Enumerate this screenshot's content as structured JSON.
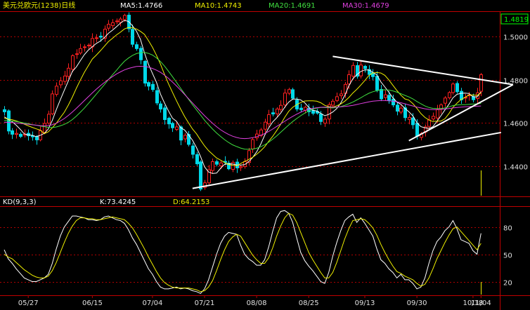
{
  "header": {
    "title": "美元兑欧元(1238)日线",
    "ma5": "MA5:1.4766",
    "ma10": "MA10:1.4743",
    "ma20": "MA20:1.4691",
    "ma30": "MA30:1.4679",
    "last_price": "1.4819"
  },
  "kd_panel": {
    "label": "KD(9,3,3)",
    "k_value": "K:73.4245",
    "d_value": "D:64.2153"
  },
  "colors": {
    "background": "#000000",
    "up_candle": "#ff2020",
    "down_candle": "#00d8e8",
    "ma5": "#ffffff",
    "ma10": "#f0f000",
    "ma20": "#40e040",
    "ma30": "#e040e0",
    "grid": "#b00000",
    "axis_text": "#e0e0e0",
    "trendline": "#ffffff",
    "k_line": "#ffffff",
    "d_line": "#f0f000",
    "last_price_box": "#00ff00",
    "volume_bar": "#f0f000"
  },
  "chart_data": [
    {
      "type": "candlestick",
      "title": "美元兑欧元(1238)日线",
      "ylim": [
        1.426,
        1.5115
      ],
      "y_ticks": [
        "1.5000",
        "1.4800",
        "1.4600",
        "1.4400"
      ],
      "y_tick_values": [
        1.5,
        1.48,
        1.46,
        1.44
      ],
      "x_ticks": [
        "05/27",
        "06/15",
        "07/04",
        "07/21",
        "08/08",
        "08/25",
        "09/13",
        "09/30",
        "10/18",
        "11/04"
      ],
      "grid": true,
      "close": [
        1.4652,
        1.4563,
        1.4548,
        1.4552,
        1.4538,
        1.4548,
        1.4541,
        1.4536,
        1.4522,
        1.4565,
        1.4598,
        1.4641,
        1.4735,
        1.4771,
        1.4796,
        1.4818,
        1.4854,
        1.4912,
        1.4921,
        1.4945,
        1.4953,
        1.4961,
        1.4992,
        1.4995,
        1.4998,
        1.5035,
        1.5058,
        1.5065,
        1.5073,
        1.5082,
        1.5099,
        1.5037,
        1.4965,
        1.4945,
        1.4893,
        1.4785,
        1.4771,
        1.4755,
        1.4693,
        1.4665,
        1.4616,
        1.4596,
        1.4578,
        1.4582,
        1.4521,
        1.4543,
        1.4501,
        1.4455,
        1.4411,
        1.4294,
        1.4323,
        1.4383,
        1.4421,
        1.4409,
        1.4415,
        1.4418,
        1.4388,
        1.4417,
        1.4392,
        1.4398,
        1.4421,
        1.4472,
        1.4523,
        1.4549,
        1.4568,
        1.4604,
        1.4639,
        1.4642,
        1.4665,
        1.4682,
        1.4739,
        1.4755,
        1.4715,
        1.4665,
        1.4662,
        1.4673,
        1.4652,
        1.4645,
        1.4646,
        1.4607,
        1.4618,
        1.4685,
        1.4701,
        1.4722,
        1.4735,
        1.4779,
        1.4824,
        1.4867,
        1.4817,
        1.4869,
        1.4852,
        1.4825,
        1.4815,
        1.4753,
        1.4712,
        1.4731,
        1.4705,
        1.4684,
        1.4655,
        1.4669,
        1.4625,
        1.4626,
        1.4592,
        1.4539,
        1.4551,
        1.4582,
        1.4614,
        1.4631,
        1.4662,
        1.4684,
        1.4716,
        1.4741,
        1.4781,
        1.4745,
        1.4708,
        1.4719,
        1.4731,
        1.4708,
        1.474,
        1.4824
      ],
      "series": [
        {
          "name": "MA5:1.4766",
          "values": [
            1.4629,
            1.4617,
            1.4606,
            1.459,
            1.4571,
            1.455,
            1.4545,
            1.4543,
            1.4537,
            1.4543,
            1.4552,
            1.4572,
            1.4612,
            1.4662,
            1.4708,
            1.4752,
            1.4795,
            1.4839,
            1.486,
            1.4889,
            1.4917,
            1.4938,
            1.4954,
            1.4969,
            1.498,
            1.4996,
            1.5016,
            1.503,
            1.5046,
            1.5063,
            1.5076,
            1.5071,
            1.5051,
            1.5026,
            1.4988,
            1.4925,
            1.4872,
            1.483,
            1.4789,
            1.4734,
            1.4693,
            1.4656,
            1.4622,
            1.4608,
            1.4579,
            1.4568,
            1.4545,
            1.452,
            1.4486,
            1.4445,
            1.4397,
            1.4373,
            1.4366,
            1.4368,
            1.439,
            1.4409,
            1.4411,
            1.441,
            1.4406,
            1.4405,
            1.4407,
            1.442,
            1.444,
            1.4466,
            1.4501,
            1.4543,
            1.4577,
            1.4605,
            1.4624,
            1.4646,
            1.4673,
            1.4697,
            1.4711,
            1.4711,
            1.4707,
            1.4694,
            1.4673,
            1.4659,
            1.4656,
            1.4645,
            1.4634,
            1.464,
            1.4651,
            1.4667,
            1.4693,
            1.4728,
            1.4772,
            1.4805,
            1.4824,
            1.4839,
            1.4846,
            1.4846,
            1.4835,
            1.4823,
            1.4791,
            1.4767,
            1.4743,
            1.4717,
            1.4697,
            1.4687,
            1.4668,
            1.4652,
            1.4633,
            1.4602,
            1.4583,
            1.4578,
            1.4575,
            1.4583,
            1.4608,
            1.4634,
            1.4661,
            1.4687,
            1.4717,
            1.4733,
            1.4738,
            1.4739,
            1.4737,
            1.4722,
            1.4721,
            1.4744
          ]
        },
        {
          "name": "MA10:1.4743",
          "values": [
            1.4623,
            1.4618,
            1.4615,
            1.461,
            1.4603,
            1.4595,
            1.4587,
            1.458,
            1.4573,
            1.4567,
            1.4551,
            1.4559,
            1.4578,
            1.4599,
            1.4625,
            1.465,
            1.4683,
            1.472,
            1.4761,
            1.4799,
            1.4835,
            1.4866,
            1.4897,
            1.4915,
            1.4935,
            1.4956,
            1.4977,
            1.4992,
            1.5008,
            1.5021,
            1.5036,
            1.5043,
            1.5041,
            1.5036,
            1.5025,
            1.5011,
            1.4982,
            1.4951,
            1.4914,
            1.4873,
            1.4826,
            1.4782,
            1.4742,
            1.4703,
            1.4666,
            1.4631,
            1.4601,
            1.4572,
            1.455,
            1.4521,
            1.4494,
            1.4472,
            1.4455,
            1.4438,
            1.4428,
            1.4417,
            1.4408,
            1.4404,
            1.4402,
            1.4412,
            1.4422,
            1.4431,
            1.4441,
            1.4455,
            1.4471,
            1.449,
            1.4515,
            1.4538,
            1.4565,
            1.4594,
            1.4626,
            1.4654,
            1.4673,
            1.4685,
            1.4695,
            1.4702,
            1.4703,
            1.4703,
            1.4701,
            1.4694,
            1.4682,
            1.4676,
            1.4674,
            1.468,
            1.4688,
            1.4701,
            1.4718,
            1.4739,
            1.4756,
            1.4776,
            1.4797,
            1.482,
            1.4832,
            1.4834,
            1.4832,
            1.4821,
            1.48,
            1.4775,
            1.4751,
            1.4729,
            1.4712,
            1.4706,
            1.469,
            1.4668,
            1.4644,
            1.4626,
            1.4614,
            1.4607,
            1.4609,
            1.4609,
            1.462,
            1.4644,
            1.4673,
            1.4692,
            1.4709,
            1.4719,
            1.473,
            1.473,
            1.4728,
            1.474
          ]
        },
        {
          "name": "MA20:1.4691",
          "values": [
            1.4612,
            1.4611,
            1.4609,
            1.4607,
            1.4604,
            1.46,
            1.4597,
            1.4593,
            1.459,
            1.4586,
            1.4583,
            1.458,
            1.4579,
            1.4582,
            1.4587,
            1.4594,
            1.4603,
            1.4616,
            1.4632,
            1.465,
            1.4669,
            1.469,
            1.4712,
            1.4734,
            1.4756,
            1.4778,
            1.4801,
            1.4823,
            1.4844,
            1.4866,
            1.4886,
            1.4901,
            1.4913,
            1.4922,
            1.4926,
            1.4927,
            1.4923,
            1.4915,
            1.4902,
            1.4885,
            1.4864,
            1.484,
            1.4815,
            1.4789,
            1.4762,
            1.4736,
            1.471,
            1.4685,
            1.4661,
            1.4637,
            1.4613,
            1.4592,
            1.4572,
            1.4554,
            1.4538,
            1.4523,
            1.451,
            1.4499,
            1.4491,
            1.4484,
            1.4479,
            1.4478,
            1.4479,
            1.4483,
            1.449,
            1.4499,
            1.4511,
            1.4525,
            1.454,
            1.4557,
            1.4574,
            1.4591,
            1.4607,
            1.4621,
            1.4634,
            1.4646,
            1.4656,
            1.4664,
            1.4669,
            1.4672,
            1.4672,
            1.4671,
            1.467,
            1.4672,
            1.4676,
            1.4682,
            1.4689,
            1.4697,
            1.4707,
            1.4717,
            1.4728,
            1.4738,
            1.4745,
            1.475,
            1.4753,
            1.4754,
            1.4753,
            1.4749,
            1.4743,
            1.4736,
            1.4728,
            1.4721,
            1.4712,
            1.47,
            1.4689,
            1.4679,
            1.4672,
            1.4668,
            1.4667,
            1.4667,
            1.467,
            1.4675,
            1.4681,
            1.4684,
            1.4685,
            1.4685,
            1.4687,
            1.4688,
            1.4688,
            1.4691
          ]
        },
        {
          "name": "MA30:1.4679",
          "values": [
            1.4604,
            1.4603,
            1.4602,
            1.46,
            1.4598,
            1.4596,
            1.4594,
            1.4592,
            1.459,
            1.4588,
            1.4587,
            1.4588,
            1.4592,
            1.4599,
            1.4609,
            1.4621,
            1.4635,
            1.4651,
            1.4668,
            1.4686,
            1.4704,
            1.4722,
            1.474,
            1.4757,
            1.4773,
            1.4788,
            1.4802,
            1.4815,
            1.4827,
            1.4837,
            1.4846,
            1.4853,
            1.4858,
            1.4862,
            1.4863,
            1.4862,
            1.4859,
            1.4853,
            1.4845,
            1.4835,
            1.4822,
            1.4807,
            1.479,
            1.4772,
            1.4753,
            1.4733,
            1.4713,
            1.4693,
            1.4673,
            1.4653,
            1.4634,
            1.4616,
            1.4599,
            1.4583,
            1.4569,
            1.4557,
            1.4547,
            1.4539,
            1.4533,
            1.4529,
            1.4528,
            1.4529,
            1.4532,
            1.4537,
            1.4543,
            1.4551,
            1.4561,
            1.4572,
            1.4584,
            1.4596,
            1.4608,
            1.462,
            1.4631,
            1.4641,
            1.465,
            1.4658,
            1.4664,
            1.4668,
            1.4671,
            1.4673,
            1.4674,
            1.4674,
            1.4674,
            1.4674,
            1.4675,
            1.4677,
            1.4679,
            1.4682,
            1.4686,
            1.469,
            1.4694,
            1.4698,
            1.4701,
            1.4703,
            1.4704,
            1.4704,
            1.4703,
            1.4701,
            1.4698,
            1.4694,
            1.4689,
            1.4684,
            1.4679,
            1.4674,
            1.467,
            1.4666,
            1.4663,
            1.4662,
            1.4662,
            1.4663,
            1.4665,
            1.4667,
            1.467,
            1.4672,
            1.4674,
            1.4675,
            1.4676,
            1.4677,
            1.4678,
            1.4679
          ]
        }
      ]
    },
    {
      "type": "line",
      "title": "KD(9,3,3)",
      "ylim": [
        5,
        102
      ],
      "y_ticks": [
        "80",
        "50",
        "20"
      ],
      "y_tick_values": [
        80,
        50,
        20
      ],
      "grid": true,
      "series": [
        {
          "name": "K:73.4245",
          "values": [
            55,
            45,
            40,
            34,
            29,
            24,
            22,
            20,
            20,
            22,
            24,
            28,
            40,
            56,
            70,
            80,
            86,
            92,
            92,
            91,
            90,
            88,
            88,
            87,
            88,
            91,
            92,
            90,
            88,
            87,
            84,
            77,
            68,
            61,
            52,
            43,
            34,
            28,
            20,
            14,
            12,
            12,
            13,
            14,
            12,
            13,
            12,
            10,
            9,
            7,
            12,
            22,
            36,
            50,
            62,
            70,
            74,
            73,
            72,
            60,
            50,
            45,
            42,
            38,
            38,
            44,
            58,
            75,
            90,
            97,
            98,
            95,
            85,
            68,
            52,
            43,
            37,
            32,
            26,
            20,
            18,
            30,
            48,
            63,
            76,
            87,
            91,
            94,
            85,
            90,
            84,
            77,
            70,
            56,
            44,
            40,
            34,
            30,
            24,
            28,
            22,
            22,
            18,
            12,
            14,
            24,
            40,
            54,
            64,
            69,
            76,
            80,
            87,
            78,
            66,
            64,
            62,
            54,
            50,
            73
          ]
        },
        {
          "name": "D:64.2153",
          "values": [
            50,
            47,
            45,
            41,
            37,
            33,
            30,
            27,
            25,
            24,
            24,
            26,
            32,
            41,
            52,
            63,
            73,
            81,
            87,
            90,
            90,
            89,
            89,
            88,
            88,
            89,
            90,
            91,
            90,
            89,
            88,
            84,
            79,
            72,
            64,
            56,
            47,
            39,
            31,
            24,
            19,
            16,
            14,
            13,
            13,
            13,
            13,
            12,
            11,
            9,
            10,
            14,
            21,
            32,
            44,
            55,
            64,
            69,
            72,
            70,
            63,
            56,
            49,
            44,
            40,
            40,
            46,
            57,
            70,
            81,
            90,
            95,
            93,
            85,
            74,
            63,
            52,
            44,
            37,
            30,
            24,
            24,
            30,
            41,
            54,
            67,
            78,
            87,
            88,
            89,
            88,
            84,
            79,
            71,
            61,
            52,
            44,
            37,
            31,
            29,
            26,
            24,
            22,
            18,
            15,
            17,
            24,
            34,
            45,
            54,
            63,
            71,
            78,
            80,
            75,
            70,
            65,
            60,
            55,
            62
          ]
        }
      ]
    }
  ]
}
